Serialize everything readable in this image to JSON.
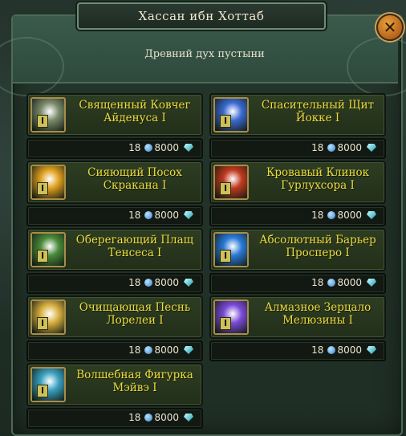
{
  "window": {
    "title": "Хассан ибн Хоттаб",
    "subtitle": "Древний дух пустыни",
    "close_icon": "close-icon"
  },
  "items": [
    {
      "name": "Священный Ковчег Айденуса I",
      "tier": "I",
      "qty": "18",
      "cost": "8000",
      "icon": "relic-ark-icon",
      "color": "#7a8a6a"
    },
    {
      "name": "Спасительный Щит Йокке I",
      "tier": "I",
      "qty": "18",
      "cost": "8000",
      "icon": "shield-icon",
      "color": "#3a6ad0"
    },
    {
      "name": "Сияющий Посох Скракана I",
      "tier": "I",
      "qty": "18",
      "cost": "8000",
      "icon": "staff-icon",
      "color": "#e0a020"
    },
    {
      "name": "Кровавый Клинок Гурлухсора I",
      "tier": "I",
      "qty": "18",
      "cost": "8000",
      "icon": "blade-icon",
      "color": "#c03a20"
    },
    {
      "name": "Оберегающий Плащ Тенсеса I",
      "tier": "I",
      "qty": "18",
      "cost": "8000",
      "icon": "cloak-icon",
      "color": "#4a8a3a"
    },
    {
      "name": "Абсолютный Барьер Просперо I",
      "tier": "I",
      "qty": "18",
      "cost": "8000",
      "icon": "barrier-icon",
      "color": "#2a7ad8"
    },
    {
      "name": "Очищающая Песнь Лорелеи I",
      "tier": "I",
      "qty": "18",
      "cost": "8000",
      "icon": "song-icon",
      "color": "#d8b040"
    },
    {
      "name": "Алмазное Зерцало Мелюзины I",
      "tier": "I",
      "qty": "18",
      "cost": "8000",
      "icon": "mirror-icon",
      "color": "#7a4ad8"
    },
    {
      "name": "Волшебная Фигурка Мэйвэ I",
      "tier": "I",
      "qty": "18",
      "cost": "8000",
      "icon": "figurine-icon",
      "color": "#3aa0c0"
    }
  ]
}
